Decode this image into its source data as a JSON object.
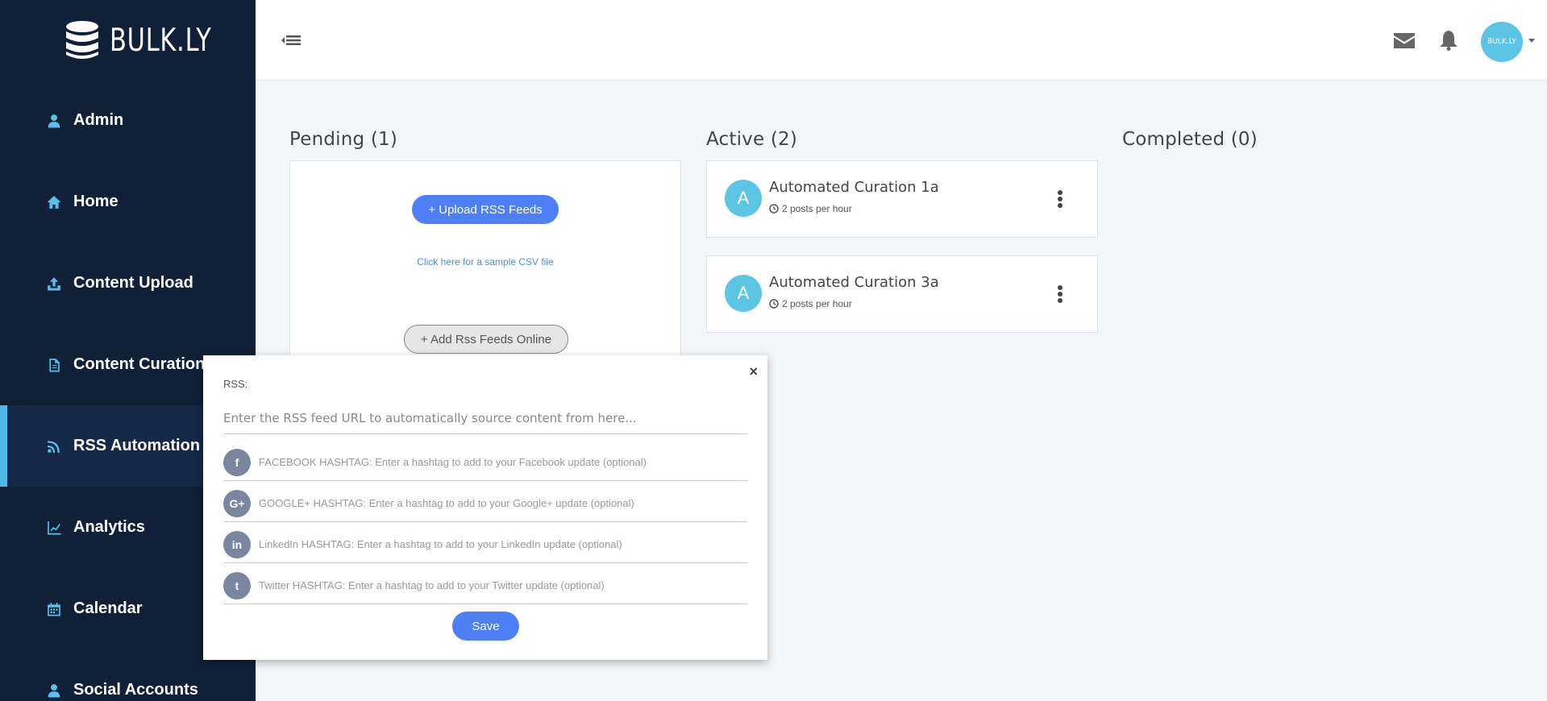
{
  "app": {
    "logo_text": "BULK.LY"
  },
  "sidebar": {
    "items": [
      {
        "label": "Admin",
        "icon": "user-icon"
      },
      {
        "label": "Home",
        "icon": "home-icon"
      },
      {
        "label": "Content Upload",
        "icon": "upload-icon"
      },
      {
        "label": "Content Curation",
        "icon": "file-icon"
      },
      {
        "label": "RSS Automation",
        "icon": "rss-icon",
        "active": true
      },
      {
        "label": "Analytics",
        "icon": "chart-icon"
      },
      {
        "label": "Calendar",
        "icon": "calendar-icon"
      },
      {
        "label": "Social Accounts",
        "icon": "user-icon"
      }
    ]
  },
  "header": {
    "avatar_text": "BULK.LY"
  },
  "columns": {
    "pending": {
      "title": "Pending (1)",
      "upload_button": "+ Upload RSS Feeds",
      "sample_link": "Click here for a sample CSV file",
      "add_online_button": "+ Add Rss Feeds Online"
    },
    "active": {
      "title": "Active (2)"
    },
    "completed": {
      "title": "Completed (0)"
    }
  },
  "active_cards": [
    {
      "avatar": "A",
      "title": "Automated Curation 1a",
      "subtitle": "2 posts per hour"
    },
    {
      "avatar": "A",
      "title": "Automated Curation 3a",
      "subtitle": "2 posts per hour"
    }
  ],
  "modal": {
    "close": "×",
    "rss_label": "RSS:",
    "rss_placeholder": "Enter the RSS feed URL to automatically source content from here...",
    "hashtags": [
      {
        "icon": "facebook-icon",
        "glyph": "f",
        "placeholder": "FACEBOOK HASHTAG: Enter a hashtag to add to your Facebook update (optional)"
      },
      {
        "icon": "google-plus-icon",
        "glyph": "G+",
        "placeholder": "GOOGLE+ HASHTAG: Enter a hashtag to add to your Google+ update (optional)"
      },
      {
        "icon": "linkedin-icon",
        "glyph": "in",
        "placeholder": "LinkedIn HASHTAG: Enter a hashtag to add to your LinkedIn update (optional)"
      },
      {
        "icon": "twitter-icon",
        "glyph": "t",
        "placeholder": "Twitter HASHTAG: Enter a hashtag to add to your Twitter update (optional)"
      }
    ],
    "save_button": "Save"
  },
  "colors": {
    "sidebar_bg": "#0f2037",
    "accent_blue": "#4e7ff5",
    "avatar_cyan": "#5bc5e3",
    "active_bar": "#4fb8e6"
  }
}
